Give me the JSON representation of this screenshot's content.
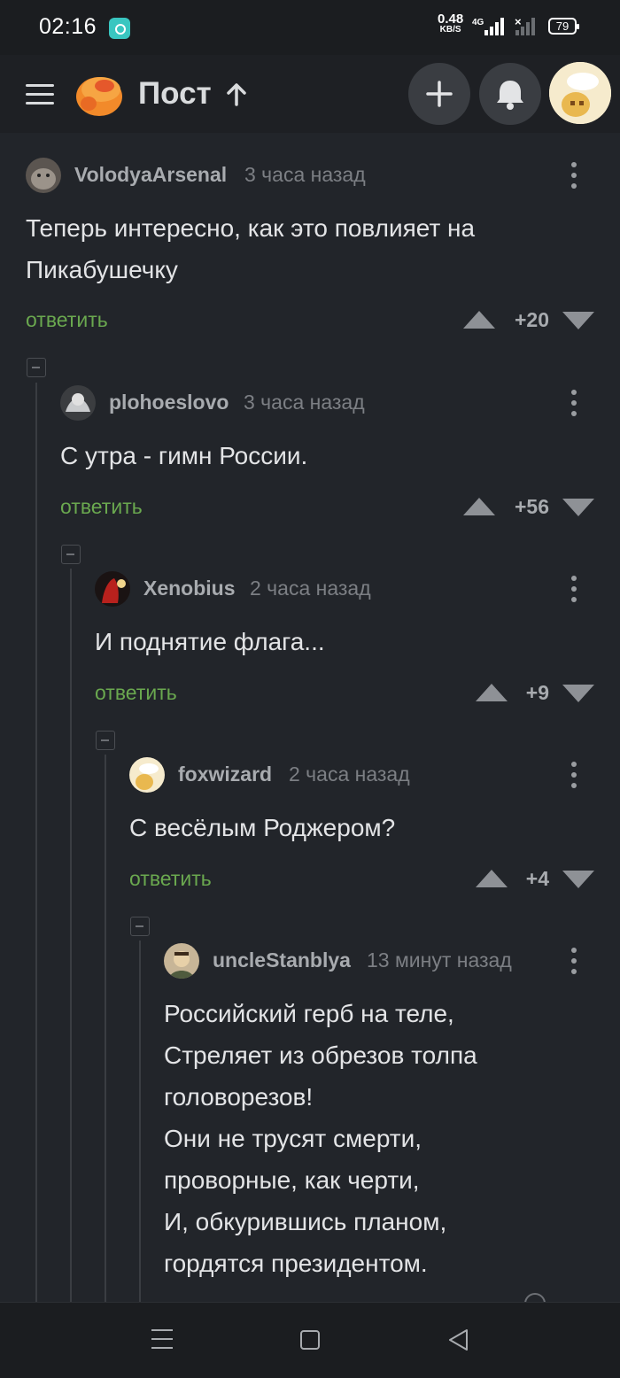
{
  "status_bar": {
    "time": "02:16",
    "speed_value": "0.48",
    "speed_unit": "KB/S",
    "network": "4G",
    "battery": "79"
  },
  "header": {
    "title": "Пост",
    "icons": [
      "menu-icon",
      "pikabu-logo",
      "arrow-up-icon",
      "plus-icon",
      "bell-icon",
      "avatar"
    ]
  },
  "comments": [
    {
      "author": "VolodyaArsenal",
      "time": "3 часа назад",
      "text": "Теперь интересно, как это повлияет на\nПикабушечку",
      "reply": "ответить",
      "score": "+20"
    },
    {
      "author": "plohoeslovo",
      "time": "3 часа назад",
      "text": "С утра - гимн России.",
      "reply": "ответить",
      "score": "+56"
    },
    {
      "author": "Xenobius",
      "time": "2 часа назад",
      "text": "И поднятие флага...",
      "reply": "ответить",
      "score": "+9"
    },
    {
      "author": "foxwizard",
      "time": "2 часа назад",
      "text": "С весёлым Роджером?",
      "reply": "ответить",
      "score": "+4"
    },
    {
      "author": "uncleStanblya",
      "time": "13 минут назад",
      "text": "Российский герб на теле,\nСтреляет из обрезов толпа\nголоворезов!\nОни не трусят смерти,\nпроворные, как черти,\nИ, обкурившись планом,\nгордятся президентом.",
      "reply": "",
      "score": ""
    }
  ],
  "colors": {
    "background": "#22252a",
    "reply_green": "#6aa84f",
    "text": "#e3e4e6",
    "muted": "#7c7f84"
  }
}
